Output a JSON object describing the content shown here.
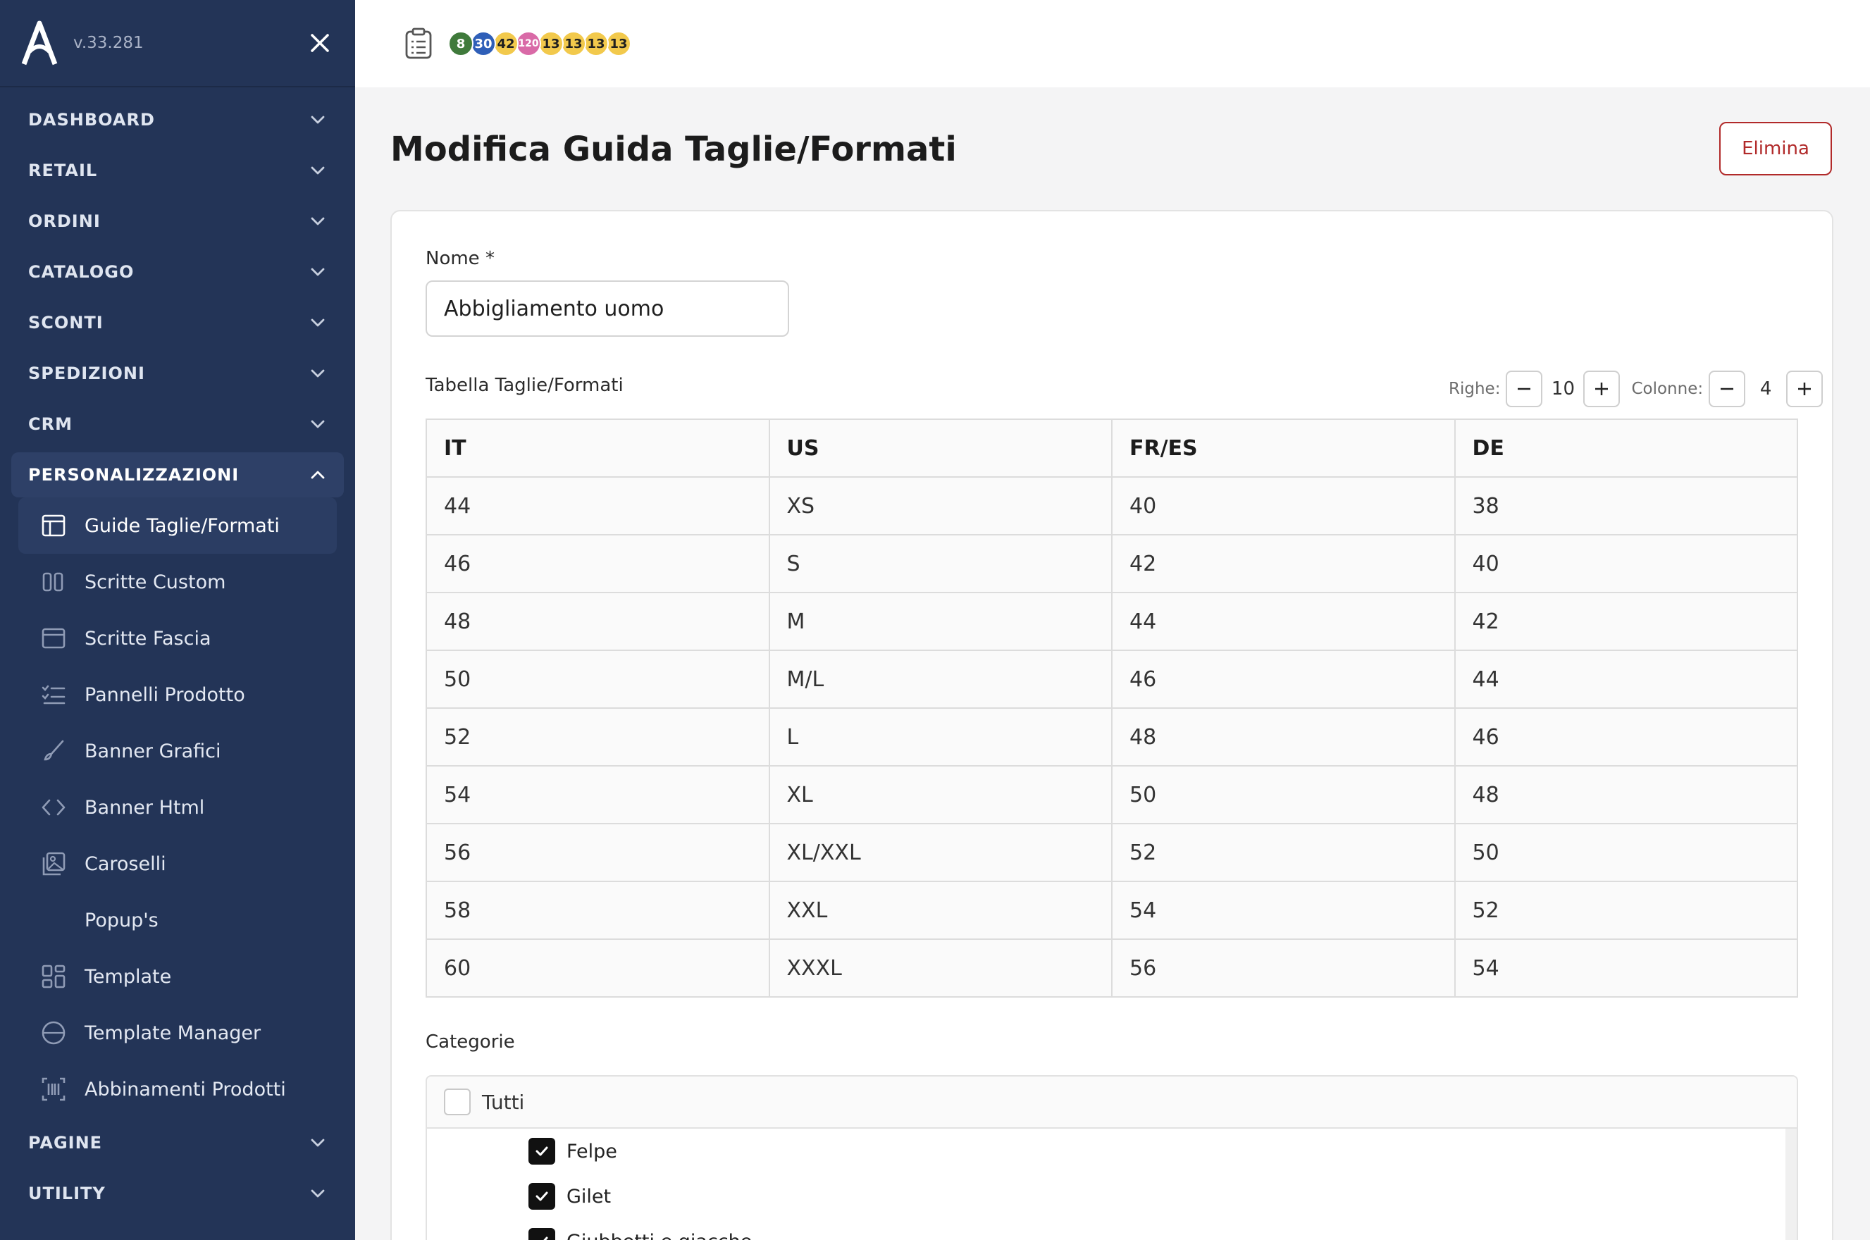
{
  "app": {
    "version": "v.33.281"
  },
  "sidebar": {
    "sections_top": [
      {
        "label": "DASHBOARD",
        "name": "sidebar-section-dashboard"
      },
      {
        "label": "RETAIL",
        "name": "sidebar-section-retail"
      },
      {
        "label": "ORDINI",
        "name": "sidebar-section-ordini"
      },
      {
        "label": "CATALOGO",
        "name": "sidebar-section-catalogo"
      },
      {
        "label": "SCONTI",
        "name": "sidebar-section-sconti"
      },
      {
        "label": "SPEDIZIONI",
        "name": "sidebar-section-spedizioni"
      },
      {
        "label": "CRM",
        "name": "sidebar-section-crm"
      }
    ],
    "open_section": "PERSONALIZZAZIONI",
    "items": [
      {
        "label": "Guide Taglie/Formati",
        "icon": "table-icon"
      },
      {
        "label": "Scritte Custom",
        "icon": "quote-icon"
      },
      {
        "label": "Scritte Fascia",
        "icon": "window-icon"
      },
      {
        "label": "Pannelli Prodotto",
        "icon": "list-icon"
      },
      {
        "label": "Banner Grafici",
        "icon": "brush-icon"
      },
      {
        "label": "Banner Html",
        "icon": "code-icon"
      },
      {
        "label": "Caroselli",
        "icon": "gallery-icon"
      },
      {
        "label": "Popup's",
        "icon": "chat-bubble-icon"
      },
      {
        "label": "Template",
        "icon": "layout-icon"
      },
      {
        "label": "Template Manager",
        "icon": "globe-icon"
      },
      {
        "label": "Abbinamenti Prodotti",
        "icon": "barcode-icon"
      }
    ],
    "sections_bottom": [
      {
        "label": "PAGINE",
        "name": "sidebar-section-pagine"
      },
      {
        "label": "UTILITY",
        "name": "sidebar-section-utility"
      }
    ]
  },
  "topbar": {
    "badges": [
      {
        "value": "8",
        "color": "#3f7a3b",
        "text_color": "#ffffff"
      },
      {
        "value": "30",
        "color": "#2f5fb8",
        "text_color": "#ffffff"
      },
      {
        "value": "42",
        "color": "#f2c94c",
        "text_color": "#1f1f1f"
      },
      {
        "value": "120",
        "color": "#d96aa7",
        "text_color": "#ffffff"
      },
      {
        "value": "13",
        "color": "#f2c94c",
        "text_color": "#1f1f1f"
      },
      {
        "value": "13",
        "color": "#f2c94c",
        "text_color": "#1f1f1f"
      },
      {
        "value": "13",
        "color": "#f2c94c",
        "text_color": "#1f1f1f"
      },
      {
        "value": "13",
        "color": "#f2c94c",
        "text_color": "#1f1f1f"
      }
    ]
  },
  "page": {
    "title": "Modifica Guida Taglie/Formati",
    "delete_label": "Elimina",
    "name_label": "Nome *",
    "name_value": "Abbigliamento uomo",
    "table_label": "Tabella Taglie/Formati",
    "rows_label": "Righe:",
    "rows_count": "10",
    "cols_label": "Colonne:",
    "cols_count": "4",
    "table": {
      "headers": [
        "IT",
        "US",
        "FR/ES",
        "DE"
      ],
      "rows": [
        [
          "44",
          "XS",
          "40",
          "38"
        ],
        [
          "46",
          "S",
          "42",
          "40"
        ],
        [
          "48",
          "M",
          "44",
          "42"
        ],
        [
          "50",
          "M/L",
          "46",
          "44"
        ],
        [
          "52",
          "L",
          "48",
          "46"
        ],
        [
          "54",
          "XL",
          "50",
          "48"
        ],
        [
          "56",
          "XL/XXL",
          "52",
          "50"
        ],
        [
          "58",
          "XXL",
          "54",
          "52"
        ],
        [
          "60",
          "XXXL",
          "56",
          "54"
        ]
      ]
    },
    "categories_label": "Categorie",
    "categories_all": "Tutti",
    "categories": [
      {
        "label": "Felpe",
        "checked": true
      },
      {
        "label": "Gilet",
        "checked": true
      },
      {
        "label": "Giubbotti e giacche",
        "checked": true
      }
    ]
  },
  "colors": {
    "sidebar_bg": "#233457",
    "danger": "#b12a2a"
  }
}
